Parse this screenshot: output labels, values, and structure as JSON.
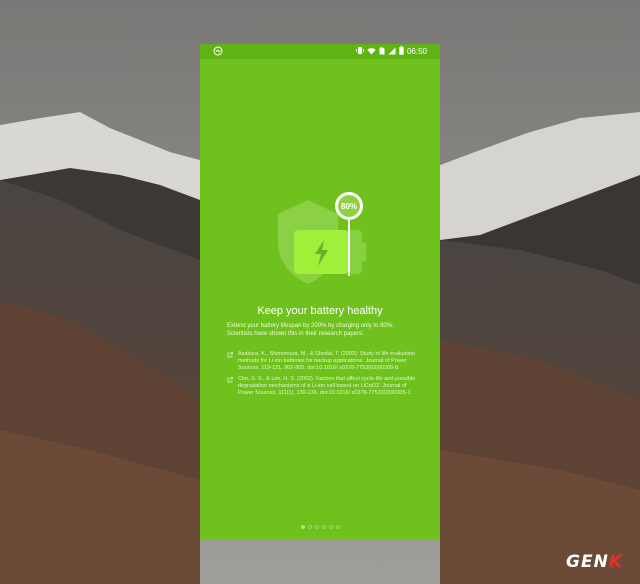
{
  "status_bar": {
    "time": "06:50",
    "left_icon": "assistant-icon",
    "right_icons": [
      "vibrate-icon",
      "wifi-icon",
      "sim-icon",
      "signal-icon",
      "battery-icon"
    ]
  },
  "hero": {
    "badge": "80%",
    "icons": [
      "shield-icon",
      "battery-icon",
      "lightning-icon"
    ]
  },
  "content": {
    "title": "Keep your battery healthy",
    "intro": "Extend your battery lifespan by 200% by charging only to 80%. Scientists have shown this in their research papers:",
    "references": [
      "Asakura, K., Shimomura, M., & Shodai, T. (2003). Study of life evaluation methods for Li-ion batteries for backup applications. Journal of Power Sources, 119-121, 902-905. doi:10.1016/ s0378-7753(03)00208-8",
      "Cho, S. S., & Lim, H. S. (2002). Factors that affect cycle-life and possible degradation mechanisms of a Li-ion cell based on LiCoO2. Journal of Power Sources, 111(1), 130-136. doi:10.1016/ s0378-7753(02)00305-1"
    ]
  },
  "pager": {
    "count": 6,
    "active_index": 0
  },
  "watermark": {
    "left": "GEN",
    "right": "K"
  },
  "colors": {
    "screen_bg": "#6fc21d",
    "status_bar": "#60b314",
    "watermark_accent": "#e5302a"
  }
}
